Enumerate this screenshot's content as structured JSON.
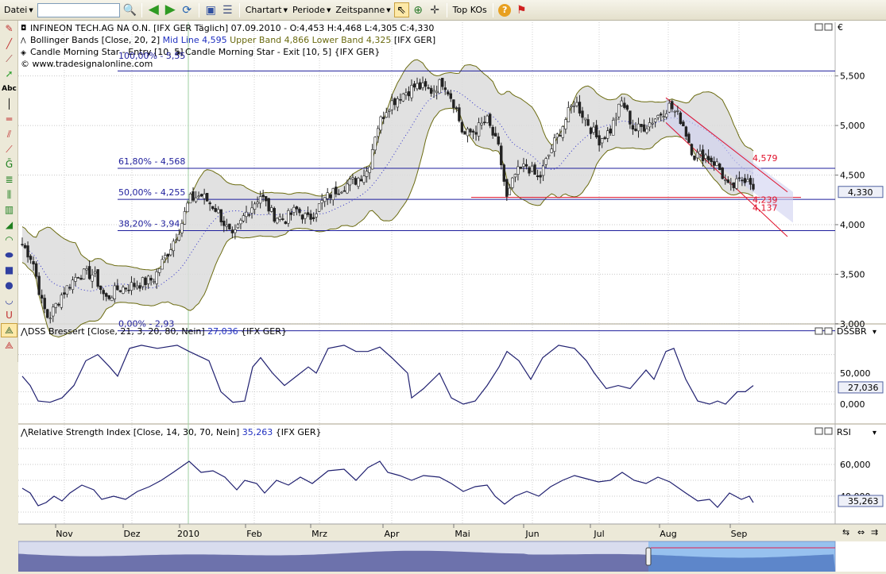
{
  "toolbar": {
    "file": "Datei",
    "search": "",
    "charttype": "Chartart",
    "period": "Periode",
    "timespan": "Zeitspanne",
    "topkos": "Top KOs"
  },
  "price_pane": {
    "title_line": "INFINEON TECH.AG NA O.N. [IFX GER  Täglich] 07.09.2010 - O:4,453 H:4,468 L:4,305 C:4,330",
    "boll_name": "Bollinger Bands [Close, 20, 2]",
    "boll_mid": "Mid Line 4,595",
    "boll_upper": "Upper Band 4,866",
    "boll_lower": "Lower Band 4,325",
    "boll_src": "[IFX GER]",
    "cms_entry": "Candle Morning Star - Entry [10, 5]",
    "cms_exit": "Candle Morning Star - Exit [10, 5] {IFX GER}",
    "site": "© www.tradesignalonline.com",
    "hidden_fib": "100,00% - 5,55",
    "currency": "€",
    "last": "4,330",
    "axis": [
      "5,500",
      "5,000",
      "4,500",
      "4,000",
      "3,500",
      "3,000"
    ],
    "fib": [
      {
        "label": "61,80% - 4,568",
        "value": 4.568
      },
      {
        "label": "50,00% - 4,255",
        "value": 4.255
      },
      {
        "label": "38,20% - 3,94",
        "value": 3.94
      },
      {
        "label": "0,00% - 2,93",
        "value": 2.93
      }
    ],
    "fib_top": 5.55,
    "channel_labels": {
      "upper": "4,579",
      "lower1": "4,239",
      "lower2": "4,137"
    }
  },
  "dss_pane": {
    "name": "DSS Bressert [Close, 21, 3, 20, 80, Nein]",
    "value": "27,036",
    "src": "{IFX GER}",
    "tag": "DSSBR",
    "axis": [
      "50,000",
      "0,000"
    ],
    "last": "27,036"
  },
  "rsi_pane": {
    "name": "Relative Strength Index [Close, 14, 30, 70, Nein]",
    "value": "35,263",
    "src": "{IFX GER}",
    "tag": "RSI",
    "axis": [
      "60,000",
      "40,000"
    ],
    "last": "35,263"
  },
  "x_axis": [
    "Nov",
    "Dez",
    "2010",
    "Feb",
    "Mrz",
    "Apr",
    "Mai",
    "Jun",
    "Jul",
    "Aug",
    "Sep"
  ],
  "colors": {
    "band": "#6b6b10",
    "fill": "#dcdcdc",
    "mid": "#3030c8",
    "fib": "#1e1e9c",
    "red": "#e0102a",
    "osc": "#202070"
  }
}
